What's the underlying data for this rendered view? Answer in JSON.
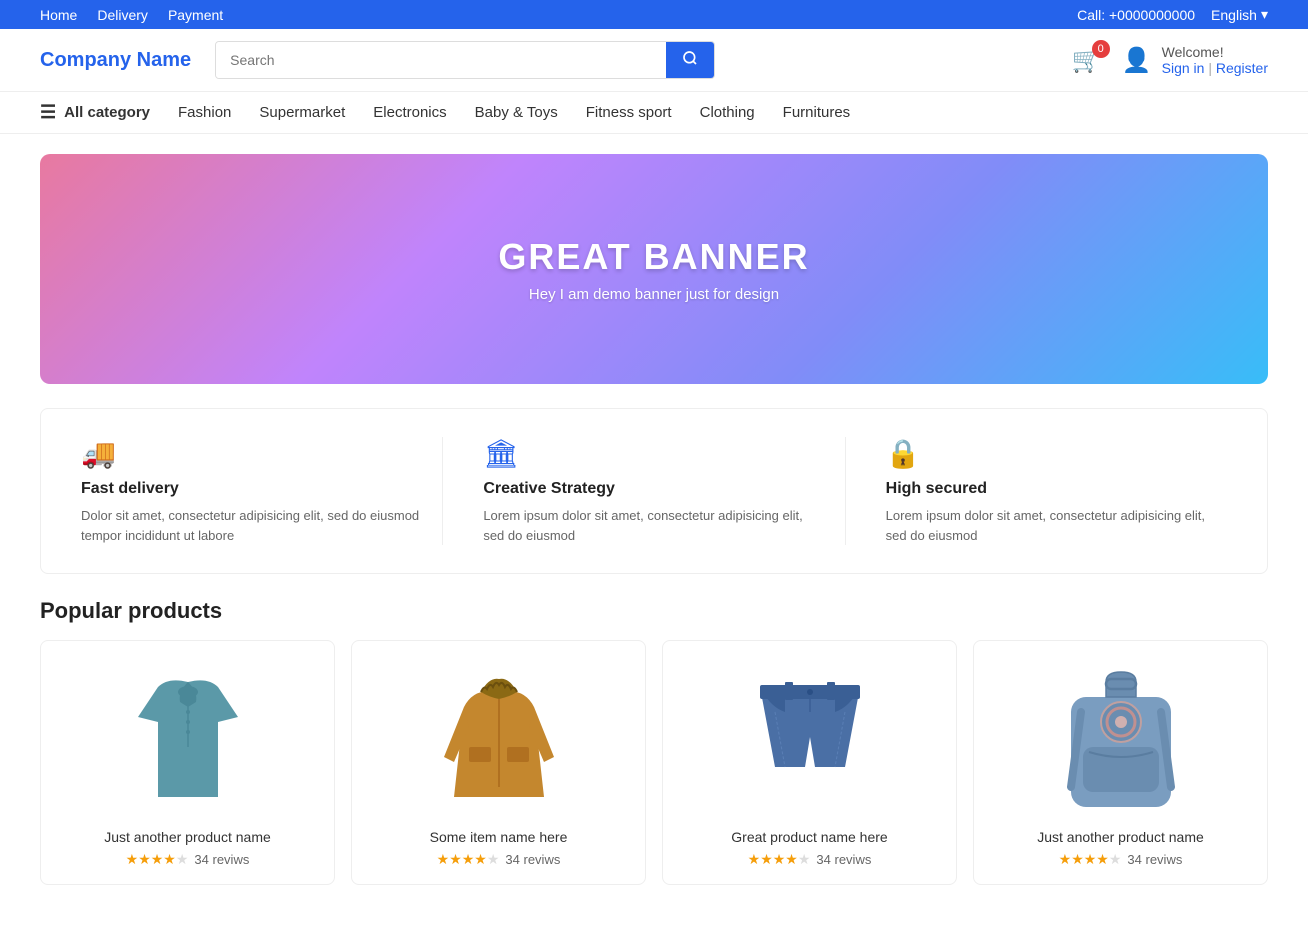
{
  "topbar": {
    "nav_links": [
      "Home",
      "Delivery",
      "Payment"
    ],
    "phone": "Call: +0000000000",
    "language": "English",
    "lang_arrow": "▾"
  },
  "header": {
    "logo": "Company Name",
    "search_placeholder": "Search",
    "cart_count": "0",
    "welcome": "Welcome!",
    "sign_in": "Sign in",
    "separator": "|",
    "register": "Register"
  },
  "nav": {
    "all_category": "All category",
    "items": [
      "Fashion",
      "Supermarket",
      "Electronics",
      "Baby &amp; Toys",
      "Fitness sport",
      "Clothing",
      "Furnitures"
    ]
  },
  "banner": {
    "title": "GREAT BANNER",
    "subtitle": "Hey I am demo banner just for design"
  },
  "features": [
    {
      "id": "fast-delivery",
      "icon": "🚚",
      "title": "Fast delivery",
      "desc": "Dolor sit amet, consectetur adipisicing elit, sed do eiusmod tempor incididunt ut labore"
    },
    {
      "id": "creative-strategy",
      "icon": "🏛",
      "title": "Creative Strategy",
      "desc": "Lorem ipsum dolor sit amet, consectetur adipisicing elit, sed do eiusmod"
    },
    {
      "id": "high-secured",
      "icon": "🔒",
      "title": "High secured",
      "desc": "Lorem ipsum dolor sit amet, consectetur adipisicing elit, sed do eiusmod"
    }
  ],
  "popular_products": {
    "section_title": "Popular products",
    "items": [
      {
        "name": "Just another product name",
        "rating": 4,
        "max_rating": 5,
        "reviews": "34 reviws",
        "color": "#5b99a8",
        "type": "shirt"
      },
      {
        "name": "Some item name here",
        "rating": 4,
        "max_rating": 5,
        "reviews": "34 reviws",
        "color": "#c4872e",
        "type": "jacket"
      },
      {
        "name": "Great product name here",
        "rating": 4,
        "max_rating": 5,
        "reviews": "34 reviws",
        "color": "#4a6fa5",
        "type": "shorts"
      },
      {
        "name": "Just another product name",
        "rating": 4,
        "max_rating": 5,
        "reviews": "34 reviws",
        "color": "#7a9dc0",
        "type": "backpack"
      }
    ]
  }
}
